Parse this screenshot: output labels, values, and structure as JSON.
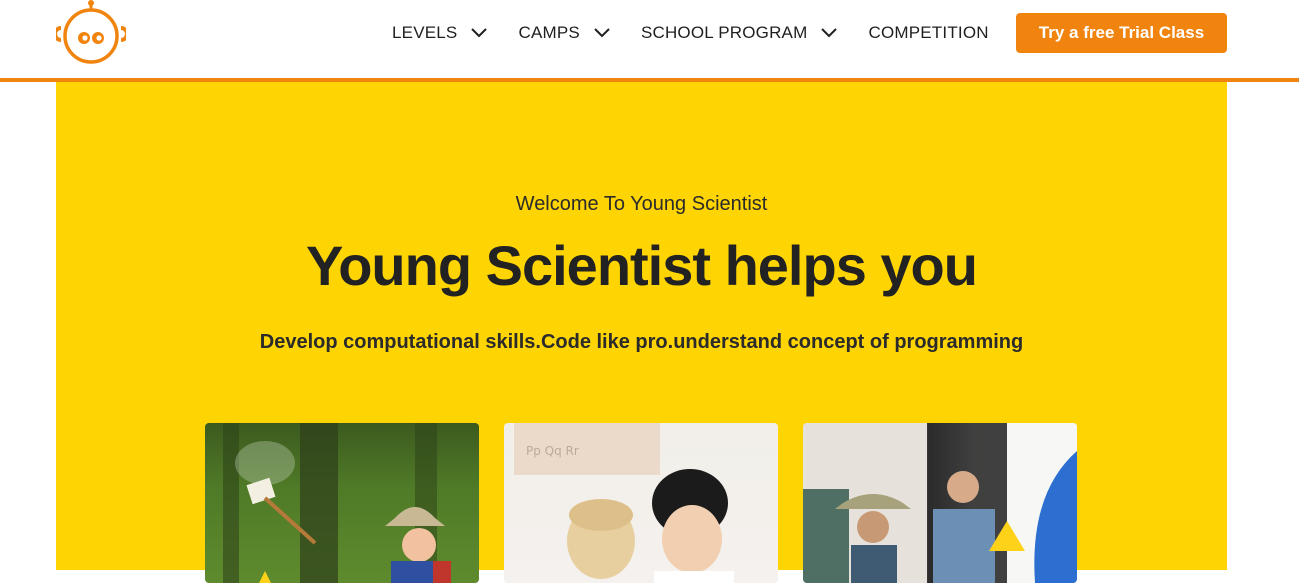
{
  "header": {
    "logo_icon": "robot-face-icon",
    "nav": [
      {
        "label": "LEVELS",
        "has_dropdown": true
      },
      {
        "label": "CAMPS",
        "has_dropdown": true
      },
      {
        "label": "SCHOOL PROGRAM",
        "has_dropdown": true
      },
      {
        "label": "COMPETITION",
        "has_dropdown": false
      }
    ],
    "cta_label": "Try a free Trial Class"
  },
  "hero": {
    "eyebrow": "Welcome To Young Scientist",
    "headline": "Young Scientist helps you",
    "subline": "Develop computational skills.Code like pro.understand concept of programming"
  },
  "cards": [
    {
      "icon": "forest-campfire-photo"
    },
    {
      "icon": "kids-studying-photo"
    },
    {
      "icon": "father-son-tent-photo"
    }
  ],
  "colors": {
    "accent": "#f0840f",
    "hero_bg": "#fed402",
    "text": "#232323"
  }
}
